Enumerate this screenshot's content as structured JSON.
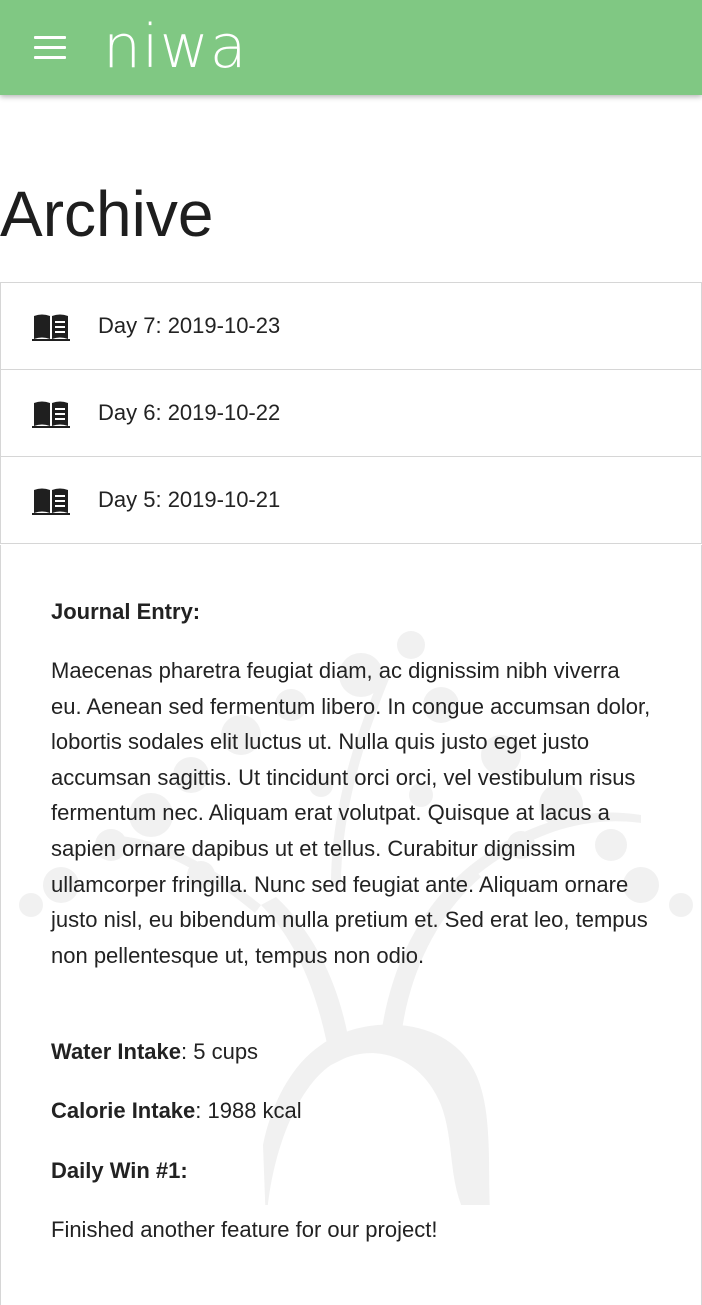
{
  "app": {
    "title": "niwa",
    "brand_color": "#80c883",
    "menu_icon": "hamburger-menu-icon"
  },
  "page": {
    "title": "Archive"
  },
  "archive": {
    "items": [
      {
        "label": "Day 7: 2019-10-23",
        "icon": "book-icon"
      },
      {
        "label": "Day 6: 2019-10-22",
        "icon": "book-icon"
      },
      {
        "label": "Day 5: 2019-10-21",
        "icon": "book-icon"
      }
    ]
  },
  "entry": {
    "journal_heading": "Journal Entry:",
    "journal_text": "Maecenas pharetra feugiat diam, ac dignissim nibh viverra eu. Aenean sed fermentum libero. In congue accumsan dolor, lobortis sodales elit luctus ut. Nulla quis justo eget justo accumsan sagittis. Ut tincidunt orci orci, vel vestibulum risus fermentum nec. Aliquam erat volutpat. Quisque at lacus a sapien ornare dapibus ut et tellus. Curabitur dignissim ullamcorper fringilla. Nunc sed feugiat ante. Aliquam ornare justo nisl, eu bibendum nulla pretium et. Sed erat leo, tempus non pellentesque ut, tempus non odio.",
    "water_label": "Water Intake",
    "water_value": ": 5 cups",
    "calorie_label": "Calorie Intake",
    "calorie_value": ": 1988 kcal",
    "daily_win_heading": "Daily Win #1:",
    "daily_win_text": "Finished another feature for our project!",
    "watermark_icon": "tree-watermark-icon"
  }
}
